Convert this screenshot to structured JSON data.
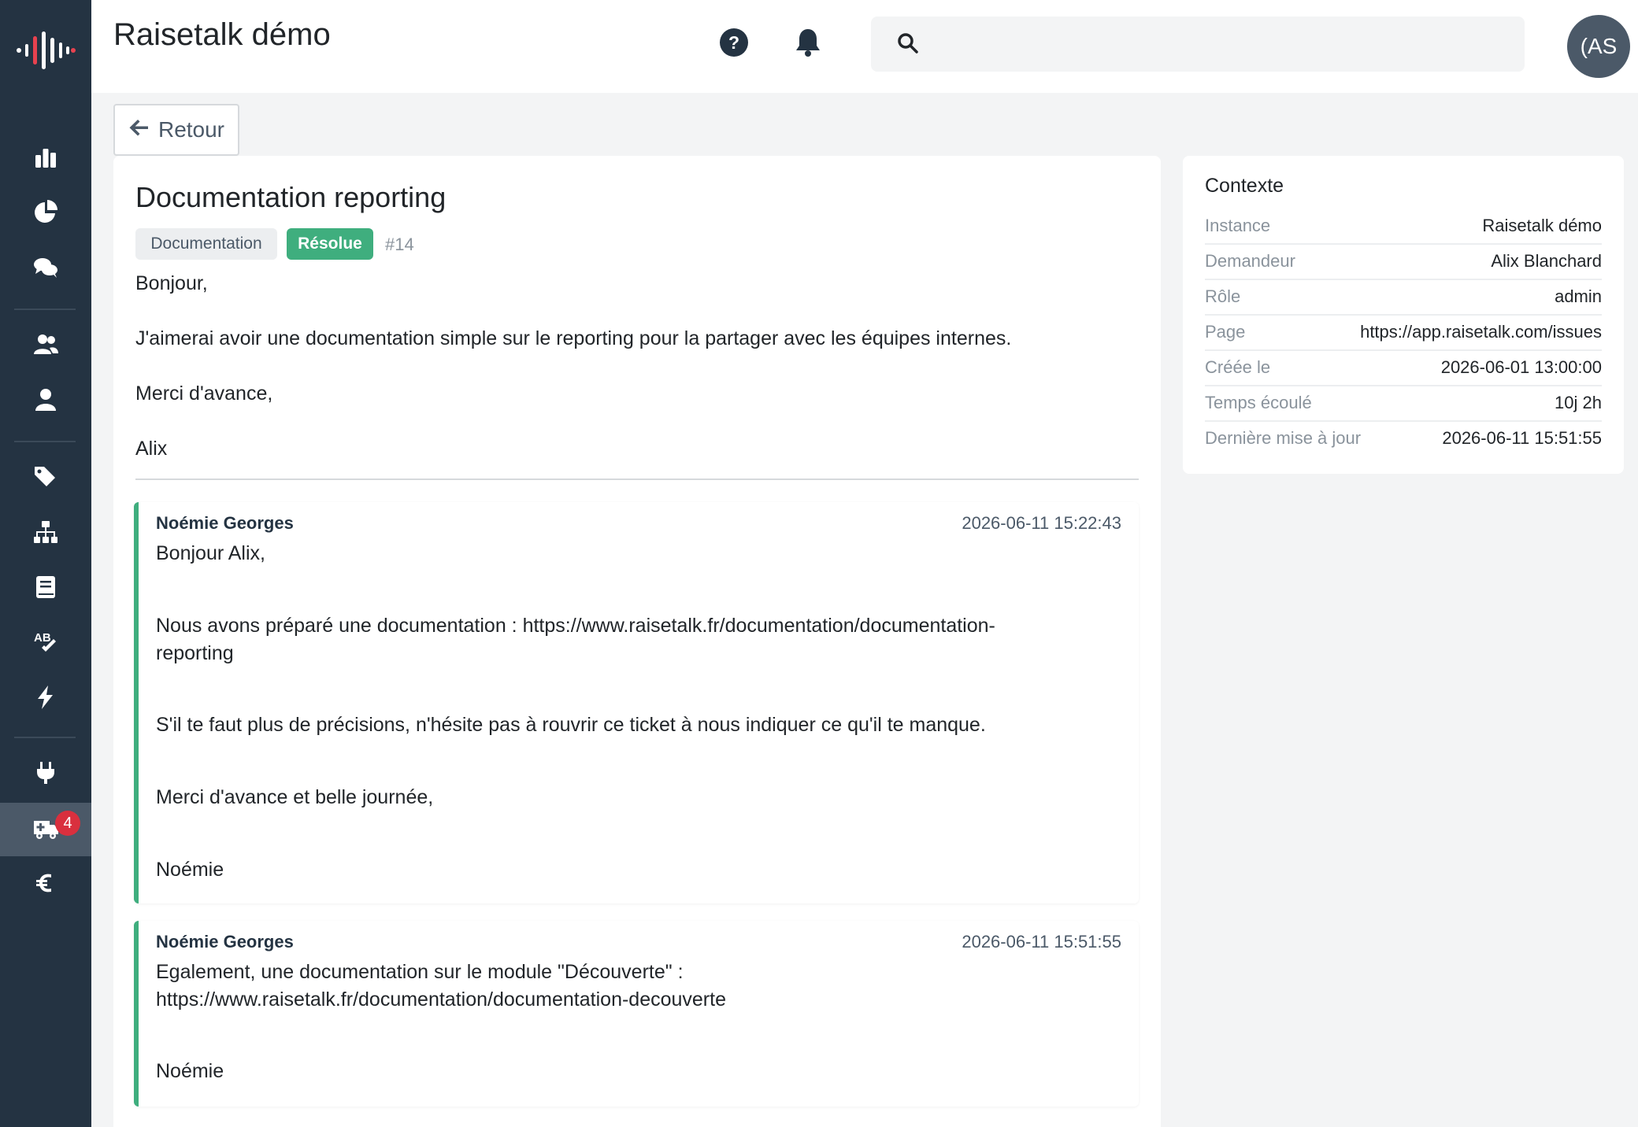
{
  "header": {
    "app_title": "Raisetalk démo",
    "search_placeholder": "",
    "avatar_initials": "(AS"
  },
  "sidebar": {
    "items": [
      {
        "icon": "bar-chart-icon"
      },
      {
        "icon": "pie-chart-icon"
      },
      {
        "icon": "comments-icon"
      },
      {
        "icon": "users-icon"
      },
      {
        "icon": "user-icon"
      },
      {
        "icon": "tags-icon"
      },
      {
        "icon": "sitemap-icon"
      },
      {
        "icon": "book-icon"
      },
      {
        "icon": "spell-check-icon"
      },
      {
        "icon": "bolt-icon"
      },
      {
        "icon": "plug-icon"
      },
      {
        "icon": "ambulance-icon",
        "badge": "4",
        "active": true
      },
      {
        "icon": "euro-icon"
      }
    ]
  },
  "back_button": {
    "label": "Retour"
  },
  "issue": {
    "title": "Documentation reporting",
    "category": "Documentation",
    "status": "Résolue",
    "number": "#14",
    "body": [
      "Bonjour,",
      "J'aimerai avoir une documentation simple sur le reporting pour la partager avec les équipes internes.",
      "Merci d'avance,",
      "Alix"
    ]
  },
  "replies": [
    {
      "author": "Noémie Georges",
      "date": "2026-06-11 15:22:43",
      "lines": [
        "Bonjour Alix,",
        "Nous avons préparé une documentation : https://www.raisetalk.fr/documentation/documentation-",
        "reporting",
        "S'il te faut plus de précisions, n'hésite pas à rouvrir ce ticket à nous indiquer ce qu'il te manque.",
        "Merci d'avance et belle journée,",
        "Noémie"
      ]
    },
    {
      "author": "Noémie Georges",
      "date": "2026-06-11 15:51:55",
      "lines": [
        "Egalement, une documentation sur le module \"Découverte\" :",
        "https://www.raisetalk.fr/documentation/documentation-decouverte",
        "Noémie"
      ]
    }
  ],
  "context": {
    "title": "Contexte",
    "rows": [
      {
        "label": "Instance",
        "value": "Raisetalk démo"
      },
      {
        "label": "Demandeur",
        "value": "Alix Blanchard"
      },
      {
        "label": "Rôle",
        "value": "admin"
      },
      {
        "label": "Page",
        "value": "https://app.raisetalk.com/issues"
      },
      {
        "label": "Créée le",
        "value": "2026-06-01 13:00:00"
      },
      {
        "label": "Temps écoulé",
        "value": "10j 2h"
      },
      {
        "label": "Dernière mise à jour",
        "value": "2026-06-11 15:51:55"
      }
    ]
  },
  "colors": {
    "sidebar_bg": "#243342",
    "accent_green": "#3fae7e",
    "badge_red": "#d9303e",
    "logo_red": "#e8424f"
  }
}
